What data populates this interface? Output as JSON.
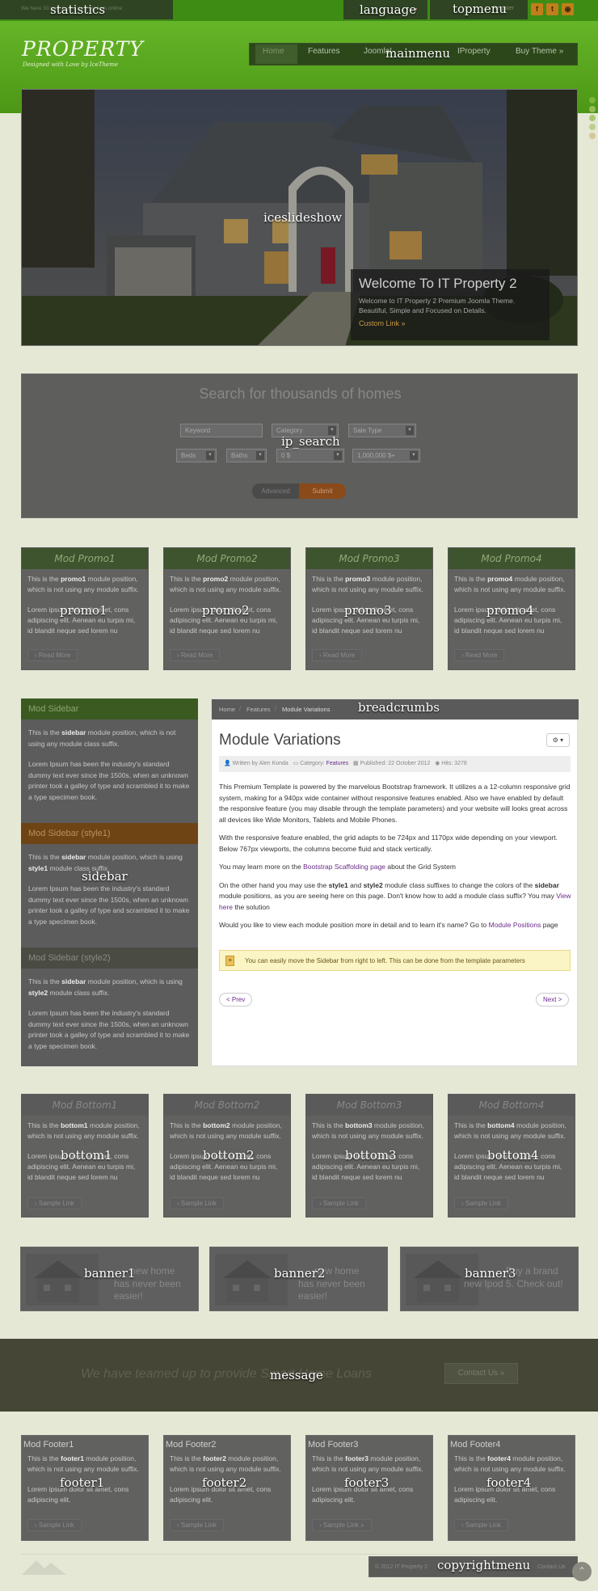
{
  "positions": {
    "statistics": "statistics",
    "language": "language",
    "topmenu": "topmenu",
    "mainmenu": "mainmenu",
    "iceslideshow": "iceslideshow",
    "ip_search": "ip_search",
    "promo1": "promo1",
    "promo2": "promo2",
    "promo3": "promo3",
    "promo4": "promo4",
    "breadcrumbs": "breadcrumbs",
    "sidebar": "sidebar",
    "bottom1": "bottom1",
    "bottom2": "bottom2",
    "bottom3": "bottom3",
    "bottom4": "bottom4",
    "banner1": "banner1",
    "banner2": "banner2",
    "banner3": "banner3",
    "message": "message",
    "footer1": "footer1",
    "footer2": "footer2",
    "footer3": "footer3",
    "footer4": "footer4",
    "copyrightmenu": "copyrightmenu"
  },
  "topbar": {
    "statistics_text": "We have 33 guests and no members online",
    "register_text": "Register"
  },
  "logo": {
    "title": "PROPERTY",
    "tagline": "Designed with Love by IceTheme"
  },
  "mainmenu": {
    "items": [
      "Home",
      "Features",
      "Joomla!",
      "IProperty",
      "Buy Theme »"
    ]
  },
  "slideshow": {
    "caption_title": "Welcome To IT Property 2",
    "caption_text": "Welcome to IT Property 2 Premium Joomla Theme. Beautiful, Simple and Focused on Details.",
    "caption_link": "Custom Link »"
  },
  "search": {
    "heading": "Search for thousands of homes",
    "keyword_placeholder": "Keyword",
    "category": "Category",
    "sale_type": "Sale Type",
    "beds": "Beds",
    "baths": "Baths",
    "price_min": "0 $",
    "price_max": "1,000,000 $+",
    "advanced_button": "Advanced",
    "submit_button": "Submit"
  },
  "promos": [
    {
      "title": "Mod Promo1",
      "name": "promo1",
      "readmore": "Read More"
    },
    {
      "title": "Mod Promo2",
      "name": "promo2",
      "readmore": "Read More"
    },
    {
      "title": "Mod Promo3",
      "name": "promo3",
      "readmore": "Read More"
    },
    {
      "title": "Mod Promo4",
      "name": "promo4",
      "readmore": "Read More"
    }
  ],
  "promo_text": {
    "pre": "This is the ",
    "post": " module position, which is not using any module suffix.",
    "lorem": "Lorem ipsum dolor sit amet, cons adipiscing elit. Aenean eu turpis mi, id blandit neque sed lorem nu"
  },
  "breadcrumbs": [
    "Home",
    "Features",
    "Module Variations"
  ],
  "sidebar": [
    {
      "title": "Mod Sidebar",
      "pre": "This is the ",
      "bold": "sidebar",
      "post": " module position, which is not using any module class suffix.",
      "lorem": "Lorem Ipsum has been the industry's standard dummy text ever since the 1500s, when an unknown printer took a galley of type and scrambled it to make a type specimen book."
    },
    {
      "title": "Mod Sidebar (style1)",
      "pre": "This is the ",
      "bold": "sidebar",
      "mid": " module position, which is using ",
      "bold2": "style1",
      "post": " module class suffix.",
      "lorem": "Lorem Ipsum has been the industry's standard dummy text ever since the 1500s, when an unknown printer took a galley of type and scrambled it to make a type specimen book."
    },
    {
      "title": "Mod Sidebar (style2)",
      "pre": "This is the ",
      "bold": "sidebar",
      "mid": " module position, which is using ",
      "bold2": "style2",
      "post": " module class suffix.",
      "lorem": "Lorem Ipsum has been the industry's standard dummy text ever since the 1500s, when an unknown printer took a galley of type and scrambled it to make a type specimen book."
    }
  ],
  "article": {
    "title": "Module Variations",
    "gear": "⚙ ▾",
    "meta_author": "Written by Alen Konda",
    "meta_category_label": "Category:",
    "meta_category": "Features",
    "meta_published": "Published: 22 October 2012",
    "meta_hits": "Hits: 3278",
    "p1": "This Premium Template is powered by the marvelous Bootstrap framework. It utilizes a a 12-column responsive grid system, making for a 940px wide container without responsive features enabled. Also we have enabled by default the responsive feature (you may disable through the template parameters) and your website will looks great across all devices like Wide Monitors, Tablets and Mobile Phones.",
    "p2": "With the responsive feature enabled, the grid adapts to be 724px and 1170px wide depending on your viewport. Below 767px viewports, the columns become fluid and stack vertically.",
    "p3_pre": "You may learn more on the ",
    "p3_link": "Bootstrap Scaffolding page",
    "p3_post": " about the Grid System",
    "p4_a": "On the other hand you may use the ",
    "p4_b": "style1",
    "p4_c": " and ",
    "p4_d": "style2",
    "p4_e": " module class suffixes to change the colors of the ",
    "p4_f": "sidebar",
    "p4_g": " module positions, as you are seeing here on this page. Don't know how to add a module class suffix? You may ",
    "p4_link": "View here",
    "p4_h": " the solution",
    "p5_pre": "Would you like to view each module position more in detail and to learn it's name? Go to ",
    "p5_link": "Module Positions",
    "p5_post": " page",
    "notice": "You can easily move the Sidebar from right to left. This can be done from the template parameters",
    "prev": "< Prev",
    "next": "Next >"
  },
  "bottoms": [
    {
      "title": "Mod Bottom1",
      "bold": "bottom1",
      "name": "bottom1",
      "link": "Sample Link"
    },
    {
      "title": "Mod Bottom2",
      "bold": "bottom2",
      "name": "bottom2",
      "link": "Sample Link"
    },
    {
      "title": "Mod Bottom3",
      "bold": "bottom3",
      "name": "bottom3",
      "link": "Sample Link"
    },
    {
      "title": "Mod Bottom4",
      "bold": "bottom4",
      "name": "bottom4",
      "link": "Sample Link"
    }
  ],
  "banners": [
    {
      "line1": "new home",
      "line2": "has never been easier!"
    },
    {
      "line1": "new home",
      "line2": "has never been easier!"
    },
    {
      "line1": "Buy a brand",
      "line2": "new Ipod 5. Check out!"
    }
  ],
  "message": {
    "text": "We have teamed up to provide Smart Home Loans",
    "button": "Contact Us »"
  },
  "footers": [
    {
      "title": "Mod Footer1",
      "bold": "footer1",
      "link": "Sample Link"
    },
    {
      "title": "Mod Footer2",
      "bold": "footer2",
      "link": "Sample Link"
    },
    {
      "title": "Mod Footer3",
      "bold": "footer3",
      "link": "Sample Link »"
    },
    {
      "title": "Mod Footer4",
      "bold": "footer4",
      "link": "Sample Link"
    }
  ],
  "footer_text": {
    "pre": "This is the ",
    "post": " module position, which is not using any module suffix.",
    "lorem": "Lorem ipsum dolor sit amet, cons adipiscing elit."
  },
  "copyright": {
    "text": "© 2012 IT Property 2",
    "link": "Contact Us"
  }
}
